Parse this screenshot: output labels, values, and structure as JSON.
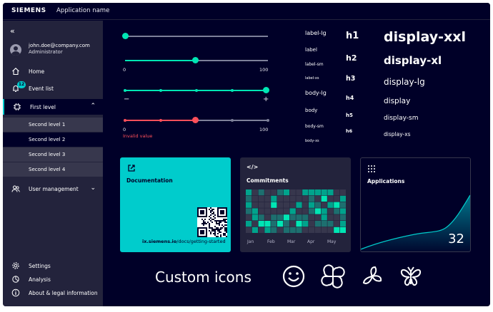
{
  "titlebar": {
    "brand": "SIEMENS",
    "app_name": "Application name"
  },
  "user": {
    "email": "john.doe@company.com",
    "role": "Administrator"
  },
  "sidebar": {
    "collapse_icon": "double-chevron-left-icon",
    "items": [
      {
        "label": "Home",
        "icon": "home-icon"
      },
      {
        "label": "Event list",
        "icon": "bell-icon",
        "badge": "12"
      },
      {
        "label": "First level",
        "icon": "chip-icon",
        "expanded": true
      },
      {
        "label": "User management",
        "icon": "user-group-icon"
      }
    ],
    "subitems": [
      {
        "label": "Second level 1"
      },
      {
        "label": "Second level 2"
      },
      {
        "label": "Second level 3"
      },
      {
        "label": "Second level 4"
      }
    ],
    "bottom_items": [
      {
        "label": "Settings",
        "icon": "gear-icon"
      },
      {
        "label": "Analysis",
        "icon": "analysis-icon"
      },
      {
        "label": "About & legal information",
        "icon": "info-icon"
      }
    ]
  },
  "sliders": {
    "slider1": {
      "value": 0
    },
    "slider2": {
      "min": "0",
      "max": "100",
      "value": 50
    },
    "slider3": {
      "minus": "−",
      "plus": "+",
      "value": 100
    },
    "slider4": {
      "min": "0",
      "max": "100",
      "value": 50,
      "error": "Invalid value"
    }
  },
  "typography": {
    "labels": [
      "label-lg",
      "label",
      "label-sm",
      "label-xs",
      "body-lg",
      "body",
      "body-sm",
      "body-xs"
    ],
    "headings": [
      "h1",
      "h2",
      "h3",
      "h4",
      "h5",
      "h6"
    ],
    "displays": [
      "display-xxl",
      "display-xl",
      "display-lg",
      "display",
      "display-sm",
      "display-xs"
    ]
  },
  "cards": {
    "documentation": {
      "title": "Documentation",
      "icon": "external-link-icon",
      "link_prefix": "ix.siemens.io",
      "link_suffix": "/docs/getting-started"
    },
    "commitments": {
      "title": "Commitments",
      "icon": "code-icon",
      "months": [
        "Jan",
        "Feb",
        "Mar",
        "Apr",
        "May"
      ]
    },
    "applications": {
      "title": "Applications",
      "icon": "grid-dots-icon",
      "count": "32"
    }
  },
  "custom_icons": {
    "title": "Custom icons",
    "icons": [
      "smiley-icon",
      "flower-icon",
      "propeller-icon",
      "butterfly-icon"
    ]
  },
  "colors": {
    "background": "#000028",
    "sidebar": "#23233c",
    "accent": "#00e6b4",
    "teal_card": "#00cccc",
    "error": "#ff4f5a"
  }
}
